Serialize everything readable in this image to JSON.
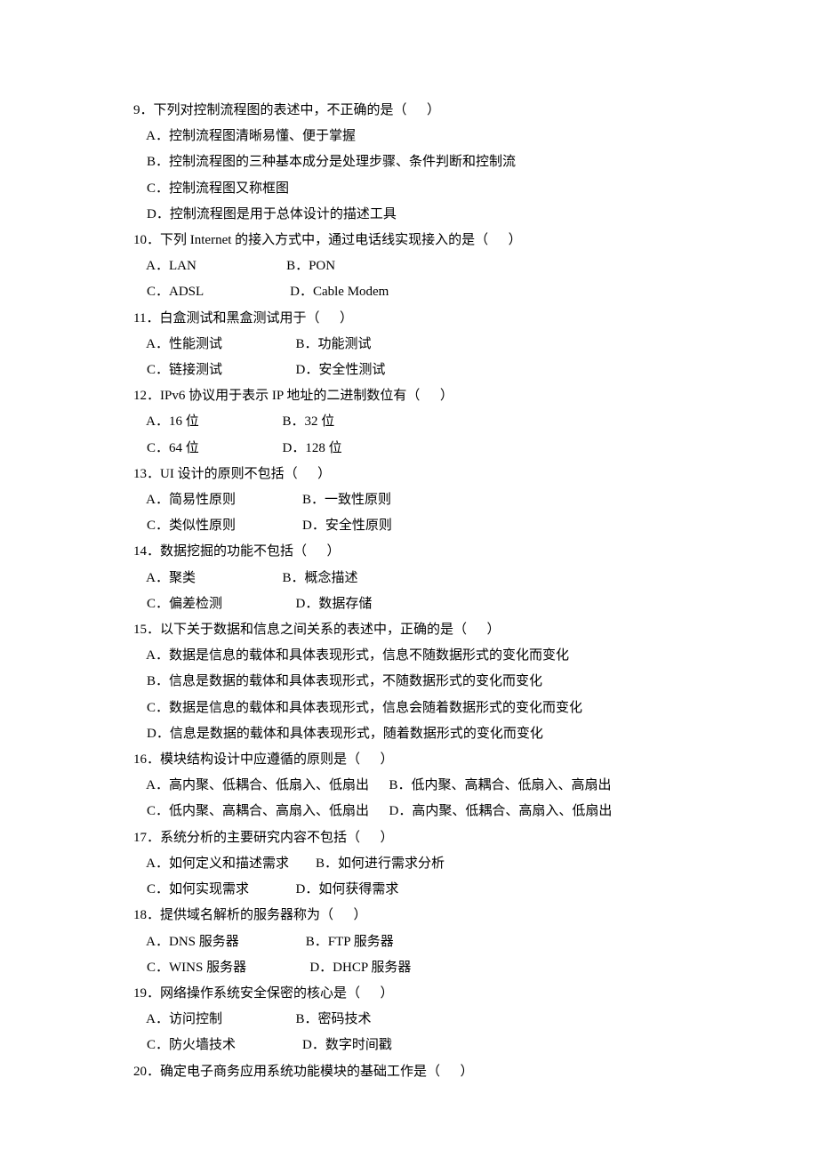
{
  "questions": [
    {
      "num": "9．",
      "text": "下列对控制流程图的表述中，不正确的是（      ）",
      "options": [
        {
          "a": "A．控制流程图清晰易懂、便于掌握"
        },
        {
          "a": "B．控制流程图的三种基本成分是处理步骤、条件判断和控制流"
        },
        {
          "a": "C．控制流程图又称框图"
        },
        {
          "a": "D．控制流程图是用于总体设计的描述工具"
        }
      ]
    },
    {
      "num": "10．",
      "text": "下列 Internet 的接入方式中，通过电话线实现接入的是（      ）",
      "options": [
        {
          "a": "A．LAN",
          "b": "B．PON"
        },
        {
          "a": "C．ADSL",
          "b": "D．Cable Modem"
        }
      ]
    },
    {
      "num": "11．",
      "text": "白盒测试和黑盒测试用于（      ）",
      "options": [
        {
          "a": "A．性能测试",
          "b": "B．功能测试"
        },
        {
          "a": "C．链接测试",
          "b": "D．安全性测试"
        }
      ]
    },
    {
      "num": "12．",
      "text": "IPv6 协议用于表示 IP 地址的二进制数位有（      ）",
      "options": [
        {
          "a": "A．16 位",
          "b": "B．32 位"
        },
        {
          "a": "C．64 位",
          "b": "D．128 位"
        }
      ]
    },
    {
      "num": "13．",
      "text": "UI 设计的原则不包括（      ）",
      "options": [
        {
          "a": "A．简易性原则",
          "b": "B．一致性原则"
        },
        {
          "a": "C．类似性原则",
          "b": "D．安全性原则"
        }
      ]
    },
    {
      "num": "14．",
      "text": "数据挖掘的功能不包括（      ）",
      "options": [
        {
          "a": "A．聚类",
          "b": "B．概念描述"
        },
        {
          "a": "C．偏差检测",
          "b": "D．数据存储"
        }
      ]
    },
    {
      "num": "15．",
      "text": "以下关于数据和信息之间关系的表述中，正确的是（      ）",
      "options": [
        {
          "a": "A．数据是信息的载体和具体表现形式，信息不随数据形式的变化而变化"
        },
        {
          "a": "B．信息是数据的载体和具体表现形式，不随数据形式的变化而变化"
        },
        {
          "a": "C．数据是信息的载体和具体表现形式，信息会随着数据形式的变化而变化"
        },
        {
          "a": "D．信息是数据的载体和具体表现形式，随着数据形式的变化而变化"
        }
      ]
    },
    {
      "num": "16．",
      "text": "模块结构设计中应遵循的原则是（      ）",
      "options": [
        {
          "a": "A．高内聚、低耦合、低扇入、低扇出",
          "b": "B．低内聚、高耦合、低扇入、高扇出"
        },
        {
          "a": "C．低内聚、高耦合、高扇入、低扇出",
          "b": "D．高内聚、低耦合、高扇入、低扇出"
        }
      ]
    },
    {
      "num": "17．",
      "text": "系统分析的主要研究内容不包括（      ）",
      "options": [
        {
          "a": "A．如何定义和描述需求",
          "b": "B．如何进行需求分析"
        },
        {
          "a": "C．如何实现需求",
          "b": "D．如何获得需求"
        }
      ]
    },
    {
      "num": "18．",
      "text": "提供域名解析的服务器称为（      ）",
      "options": [
        {
          "a": "A．DNS 服务器",
          "b": "B．FTP 服务器"
        },
        {
          "a": "C．WINS 服务器",
          "b": "D．DHCP 服务器"
        }
      ]
    },
    {
      "num": "19．",
      "text": "网络操作系统安全保密的核心是（      ）",
      "options": [
        {
          "a": "A．访问控制",
          "b": "B．密码技术"
        },
        {
          "a": "C．防火墙技术",
          "b": "D．数字时间戳"
        }
      ]
    },
    {
      "num": "20．",
      "text": "确定电子商务应用系统功能模块的基础工作是（      ）",
      "options": []
    }
  ],
  "layout": {
    "question_indent": "",
    "option_indent": "    ",
    "col_a_width_default": 16,
    "col_a_width_q16": 19,
    "col_a_width_q17": 14
  }
}
